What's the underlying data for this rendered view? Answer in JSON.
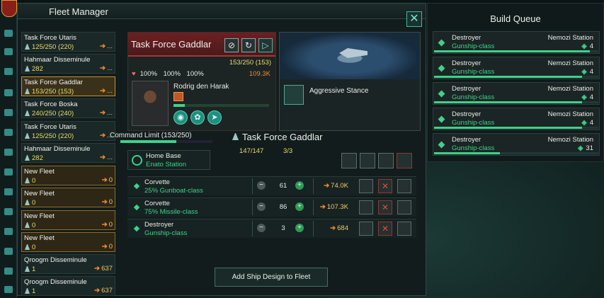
{
  "fleet_manager": {
    "title": "Fleet Manager",
    "close_glyph": "✕",
    "fleets": [
      {
        "name": "Task Force Utaris",
        "power": "125/250 (220)",
        "extra": "...",
        "style": "normal"
      },
      {
        "name": "Hahmaar Disseminule",
        "power": "282",
        "extra": "...",
        "style": "normal"
      },
      {
        "name": "Task Force Gaddlar",
        "power": "153/250 (153)",
        "extra": "...",
        "style": "selected"
      },
      {
        "name": "Task Force Boska",
        "power": "240/250 (240)",
        "extra": "...",
        "style": "normal"
      },
      {
        "name": "Task Force Utaris",
        "power": "125/250 (220)",
        "extra": "...",
        "style": "normal"
      },
      {
        "name": "Hahmaar Disseminule",
        "power": "282",
        "extra": "...",
        "style": "normal"
      },
      {
        "name": "New Fleet",
        "power": "0",
        "extra": "0",
        "style": "new"
      },
      {
        "name": "New Fleet",
        "power": "0",
        "extra": "0",
        "style": "new"
      },
      {
        "name": "New Fleet",
        "power": "0",
        "extra": "0",
        "style": "new"
      },
      {
        "name": "New Fleet",
        "power": "0",
        "extra": "0",
        "style": "new"
      },
      {
        "name": "Qroogm Disseminule",
        "power": "1",
        "extra": "637",
        "style": "normal"
      },
      {
        "name": "Qroogm Disseminule",
        "power": "1",
        "extra": "637",
        "style": "normal"
      }
    ]
  },
  "detail": {
    "fleet_name": "Task Force Gaddlar",
    "power": "153/250 (153)",
    "hull_pct": "100%",
    "armor_pct": "100%",
    "shield_pct": "100%",
    "fleet_power": "109.3K",
    "admiral_name": "Rodrig den Harak",
    "admiral_xp": 0.12,
    "stance": "Aggressive Stance",
    "command_limit": "Command Limit (153/250)",
    "command_fill": 0.61,
    "title2": "Task Force Gaddlar",
    "hull_points": "147/147",
    "ship_count": "3/3",
    "home_label": "Home Base",
    "home_value": "Enato Station",
    "add_button": "Add Ship Design to Fleet"
  },
  "ships": [
    {
      "type": "Corvette",
      "design": "25% Gunboat-class",
      "count": "61",
      "power": "74.0K"
    },
    {
      "type": "Corvette",
      "design": "75% Missile-class",
      "count": "86",
      "power": "107.3K"
    },
    {
      "type": "Destroyer",
      "design": "Gunship-class",
      "count": "3",
      "power": "684"
    }
  ],
  "build_queue": {
    "title": "Build Queue",
    "items": [
      {
        "type": "Destroyer",
        "design": "Gunship-class",
        "station": "Nemozi Station",
        "time": "4",
        "progress": 0.95
      },
      {
        "type": "Destroyer",
        "design": "Gunship-class",
        "station": "Nemozi Station",
        "time": "4",
        "progress": 0.9
      },
      {
        "type": "Destroyer",
        "design": "Gunship-class",
        "station": "Nemozi Station",
        "time": "4",
        "progress": 0.9
      },
      {
        "type": "Destroyer",
        "design": "Gunship-class",
        "station": "Nemozi Station",
        "time": "4",
        "progress": 0.9
      },
      {
        "type": "Destroyer",
        "design": "Gunship-class",
        "station": "Nemozi Station",
        "time": "31",
        "progress": 0.4
      }
    ]
  },
  "colors": {
    "accent": "#3fd18a",
    "power": "#e6dd6a",
    "selected": "#c3922f"
  }
}
